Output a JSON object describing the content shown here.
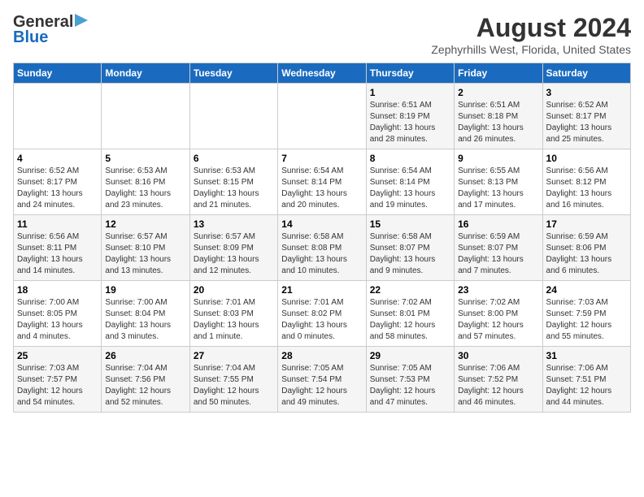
{
  "header": {
    "logo_line1": "General",
    "logo_line2": "Blue",
    "title": "August 2024",
    "subtitle": "Zephyrhills West, Florida, United States"
  },
  "calendar": {
    "days_of_week": [
      "Sunday",
      "Monday",
      "Tuesday",
      "Wednesday",
      "Thursday",
      "Friday",
      "Saturday"
    ],
    "weeks": [
      {
        "days": [
          {
            "number": "",
            "info": ""
          },
          {
            "number": "",
            "info": ""
          },
          {
            "number": "",
            "info": ""
          },
          {
            "number": "",
            "info": ""
          },
          {
            "number": "1",
            "info": "Sunrise: 6:51 AM\nSunset: 8:19 PM\nDaylight: 13 hours and 28 minutes."
          },
          {
            "number": "2",
            "info": "Sunrise: 6:51 AM\nSunset: 8:18 PM\nDaylight: 13 hours and 26 minutes."
          },
          {
            "number": "3",
            "info": "Sunrise: 6:52 AM\nSunset: 8:17 PM\nDaylight: 13 hours and 25 minutes."
          }
        ]
      },
      {
        "days": [
          {
            "number": "4",
            "info": "Sunrise: 6:52 AM\nSunset: 8:17 PM\nDaylight: 13 hours and 24 minutes."
          },
          {
            "number": "5",
            "info": "Sunrise: 6:53 AM\nSunset: 8:16 PM\nDaylight: 13 hours and 23 minutes."
          },
          {
            "number": "6",
            "info": "Sunrise: 6:53 AM\nSunset: 8:15 PM\nDaylight: 13 hours and 21 minutes."
          },
          {
            "number": "7",
            "info": "Sunrise: 6:54 AM\nSunset: 8:14 PM\nDaylight: 13 hours and 20 minutes."
          },
          {
            "number": "8",
            "info": "Sunrise: 6:54 AM\nSunset: 8:14 PM\nDaylight: 13 hours and 19 minutes."
          },
          {
            "number": "9",
            "info": "Sunrise: 6:55 AM\nSunset: 8:13 PM\nDaylight: 13 hours and 17 minutes."
          },
          {
            "number": "10",
            "info": "Sunrise: 6:56 AM\nSunset: 8:12 PM\nDaylight: 13 hours and 16 minutes."
          }
        ]
      },
      {
        "days": [
          {
            "number": "11",
            "info": "Sunrise: 6:56 AM\nSunset: 8:11 PM\nDaylight: 13 hours and 14 minutes."
          },
          {
            "number": "12",
            "info": "Sunrise: 6:57 AM\nSunset: 8:10 PM\nDaylight: 13 hours and 13 minutes."
          },
          {
            "number": "13",
            "info": "Sunrise: 6:57 AM\nSunset: 8:09 PM\nDaylight: 13 hours and 12 minutes."
          },
          {
            "number": "14",
            "info": "Sunrise: 6:58 AM\nSunset: 8:08 PM\nDaylight: 13 hours and 10 minutes."
          },
          {
            "number": "15",
            "info": "Sunrise: 6:58 AM\nSunset: 8:07 PM\nDaylight: 13 hours and 9 minutes."
          },
          {
            "number": "16",
            "info": "Sunrise: 6:59 AM\nSunset: 8:07 PM\nDaylight: 13 hours and 7 minutes."
          },
          {
            "number": "17",
            "info": "Sunrise: 6:59 AM\nSunset: 8:06 PM\nDaylight: 13 hours and 6 minutes."
          }
        ]
      },
      {
        "days": [
          {
            "number": "18",
            "info": "Sunrise: 7:00 AM\nSunset: 8:05 PM\nDaylight: 13 hours and 4 minutes."
          },
          {
            "number": "19",
            "info": "Sunrise: 7:00 AM\nSunset: 8:04 PM\nDaylight: 13 hours and 3 minutes."
          },
          {
            "number": "20",
            "info": "Sunrise: 7:01 AM\nSunset: 8:03 PM\nDaylight: 13 hours and 1 minute."
          },
          {
            "number": "21",
            "info": "Sunrise: 7:01 AM\nSunset: 8:02 PM\nDaylight: 13 hours and 0 minutes."
          },
          {
            "number": "22",
            "info": "Sunrise: 7:02 AM\nSunset: 8:01 PM\nDaylight: 12 hours and 58 minutes."
          },
          {
            "number": "23",
            "info": "Sunrise: 7:02 AM\nSunset: 8:00 PM\nDaylight: 12 hours and 57 minutes."
          },
          {
            "number": "24",
            "info": "Sunrise: 7:03 AM\nSunset: 7:59 PM\nDaylight: 12 hours and 55 minutes."
          }
        ]
      },
      {
        "days": [
          {
            "number": "25",
            "info": "Sunrise: 7:03 AM\nSunset: 7:57 PM\nDaylight: 12 hours and 54 minutes."
          },
          {
            "number": "26",
            "info": "Sunrise: 7:04 AM\nSunset: 7:56 PM\nDaylight: 12 hours and 52 minutes."
          },
          {
            "number": "27",
            "info": "Sunrise: 7:04 AM\nSunset: 7:55 PM\nDaylight: 12 hours and 50 minutes."
          },
          {
            "number": "28",
            "info": "Sunrise: 7:05 AM\nSunset: 7:54 PM\nDaylight: 12 hours and 49 minutes."
          },
          {
            "number": "29",
            "info": "Sunrise: 7:05 AM\nSunset: 7:53 PM\nDaylight: 12 hours and 47 minutes."
          },
          {
            "number": "30",
            "info": "Sunrise: 7:06 AM\nSunset: 7:52 PM\nDaylight: 12 hours and 46 minutes."
          },
          {
            "number": "31",
            "info": "Sunrise: 7:06 AM\nSunset: 7:51 PM\nDaylight: 12 hours and 44 minutes."
          }
        ]
      }
    ]
  }
}
